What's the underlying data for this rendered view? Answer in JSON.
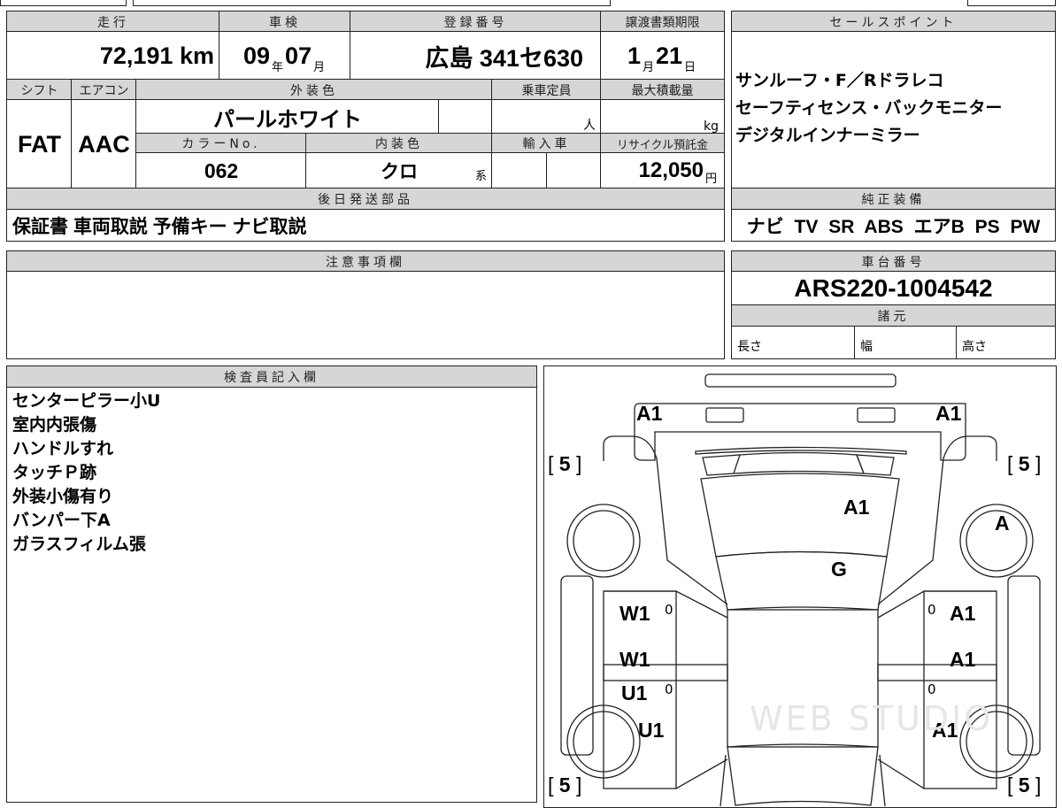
{
  "main": {
    "mileage_label": "走行",
    "mileage": "72,191",
    "mileage_unit": "km",
    "inspection_label": "車検",
    "inspection_year": "09",
    "year_unit": "年",
    "inspection_month": "07",
    "month_unit": "月",
    "registration_label": "登録番号",
    "registration": "広島 341セ630",
    "transfer_label": "譲渡書類期限",
    "transfer_month": "1",
    "transfer_day": "21",
    "day_unit": "日",
    "shift_label": "シフト",
    "shift": "FAT",
    "ac_label": "エアコン",
    "ac": "AAC",
    "exterior_label": "外装色",
    "exterior": "パールホワイト",
    "capacity_label": "乗車定員",
    "capacity_unit": "人",
    "maxload_label": "最大積載量",
    "maxload_unit": "kg",
    "color_no_label": "カラーNo.",
    "color_no": "062",
    "interior_label": "内装色",
    "interior": "クロ",
    "interior_suffix": "系",
    "import_label": "輸入車",
    "recycle_label": "リサイクル預託金",
    "recycle": "12,050",
    "recycle_unit": "円",
    "later_parts_label": "後日発送部品",
    "later_parts": "保証書 車両取説 予備キー ナビ取説"
  },
  "sales": {
    "label": "セールスポイント",
    "lines": [
      "サンルーフ・F／Rドラレコ",
      "セーフティセンス・バックモニター",
      "デジタルインナーミラー"
    ]
  },
  "equipment": {
    "label": "純正装備",
    "value": "ナビ TV SR ABS エアB PS PW"
  },
  "notes": {
    "label": "注意事項欄"
  },
  "chassis": {
    "label": "車台番号",
    "value": "ARS220-1004542",
    "spec_label": "諸元",
    "length": "長さ",
    "width": "幅",
    "height": "高さ"
  },
  "inspector": {
    "label": "検査員記入欄",
    "lines": [
      "センターピラー小U",
      "室内内張傷",
      "ハンドルすれ",
      "タッチＰ跡",
      "外装小傷有り",
      "バンパー下A",
      "ガラスフィルム張"
    ]
  },
  "diagram": {
    "marks": {
      "front_left": "A1",
      "front_right": "A1",
      "hood": "A1",
      "wheel_fr": "A",
      "roof_front": "G",
      "door_l1": "W1",
      "door_r1": "A1",
      "door_l2": "W1",
      "door_l2b": "U1",
      "door_r2": "A1",
      "rear_l": "U1",
      "rear_r": "A1"
    },
    "tire": "5",
    "bracket_open": "[",
    "bracket_close": "]",
    "zero": "0",
    "watermark": "WEB STUDIO"
  }
}
